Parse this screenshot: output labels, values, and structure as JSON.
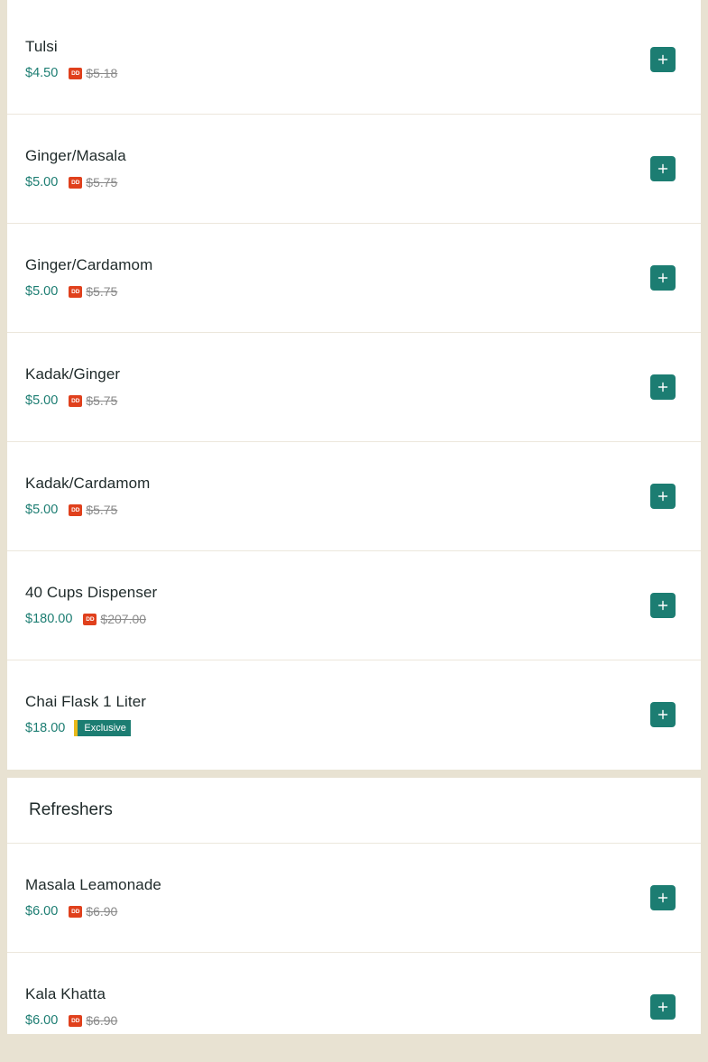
{
  "sections": [
    {
      "title": "",
      "items": [
        {
          "name": "Tulsi",
          "price": "$4.50",
          "badge": "DD",
          "old_price": "$5.18"
        },
        {
          "name": "Ginger/Masala",
          "price": "$5.00",
          "badge": "DD",
          "old_price": "$5.75"
        },
        {
          "name": "Ginger/Cardamom",
          "price": "$5.00",
          "badge": "DD",
          "old_price": "$5.75"
        },
        {
          "name": "Kadak/Ginger",
          "price": "$5.00",
          "badge": "DD",
          "old_price": "$5.75"
        },
        {
          "name": "Kadak/Cardamom",
          "price": "$5.00",
          "badge": "DD",
          "old_price": "$5.75"
        },
        {
          "name": "40 Cups Dispenser",
          "price": "$180.00",
          "badge": "DD",
          "old_price": "$207.00"
        },
        {
          "name": "Chai Flask 1 Liter",
          "price": "$18.00",
          "tag": "Exclusive"
        }
      ]
    },
    {
      "title": "Refreshers",
      "items": [
        {
          "name": "Masala Leamonade",
          "price": "$6.00",
          "badge": "DD",
          "old_price": "$6.90"
        },
        {
          "name": "Kala Khatta",
          "price": "$6.00",
          "badge": "DD",
          "old_price": "$6.90"
        }
      ]
    }
  ],
  "icons": {
    "add": "plus-icon"
  },
  "colors": {
    "accent": "#1c7d72",
    "badge": "#e0401c",
    "tag_stripe": "#e8b91a",
    "background": "#e8e2d2"
  }
}
